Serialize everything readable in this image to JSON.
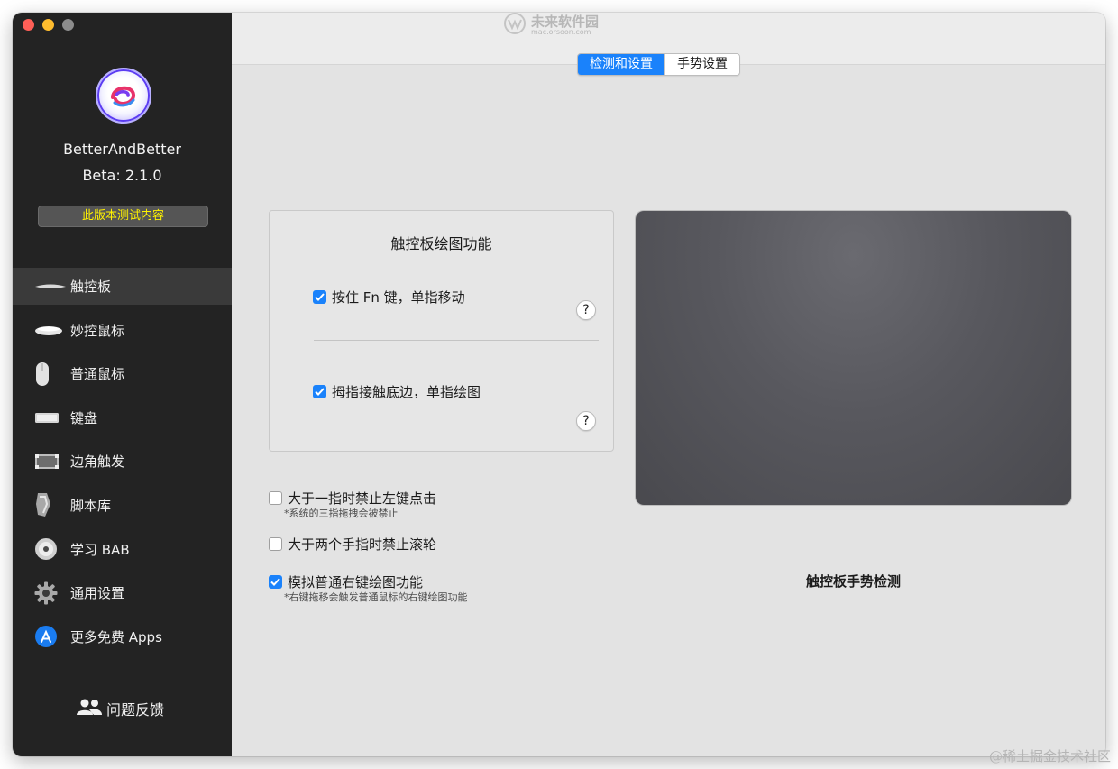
{
  "watermark": {
    "title": "未来软件园",
    "subtitle": "mac.orsoon.com"
  },
  "sidebar": {
    "app_name": "BetterAndBetter",
    "app_version": "Beta: 2.1.0",
    "beta_button": "此版本测试内容",
    "items": [
      {
        "label": "触控板",
        "icon": "trackpad-icon",
        "active": true
      },
      {
        "label": "妙控鼠标",
        "icon": "magic-mouse-icon",
        "active": false
      },
      {
        "label": "普通鼠标",
        "icon": "mouse-icon",
        "active": false
      },
      {
        "label": "键盘",
        "icon": "keyboard-icon",
        "active": false
      },
      {
        "label": "边角触发",
        "icon": "hot-corner-icon",
        "active": false
      },
      {
        "label": "脚本库",
        "icon": "script-icon",
        "active": false
      },
      {
        "label": "学习 BAB",
        "icon": "dvd-icon",
        "active": false
      },
      {
        "label": "通用设置",
        "icon": "gear-icon",
        "active": false
      },
      {
        "label": "更多免费 Apps",
        "icon": "app-store-icon",
        "active": false
      }
    ],
    "feedback": "问题反馈"
  },
  "tabs": [
    {
      "label": "检测和设置",
      "active": true
    },
    {
      "label": "手势设置",
      "active": false
    }
  ],
  "group": {
    "title": "触控板绘图功能",
    "option1": {
      "label": "按住 Fn 键，单指移动",
      "checked": true
    },
    "option2": {
      "label": "拇指接触底边，单指绘图",
      "checked": true
    },
    "help": "?"
  },
  "options": {
    "opt1": {
      "label": "大于一指时禁止左键点击",
      "note": "*系统的三指拖拽会被禁止",
      "checked": false
    },
    "opt2": {
      "label": "大于两个手指时禁止滚轮",
      "checked": false
    },
    "opt3": {
      "label": "模拟普通右键绘图功能",
      "note": "*右键拖移会触发普通鼠标的右键绘图功能",
      "checked": true
    }
  },
  "trackpad_label": "触控板手势检测",
  "credit": "@稀土掘金技术社区",
  "colors": {
    "accent": "#1a82fb",
    "sidebar": "#232323",
    "beta_text": "#fff200"
  }
}
